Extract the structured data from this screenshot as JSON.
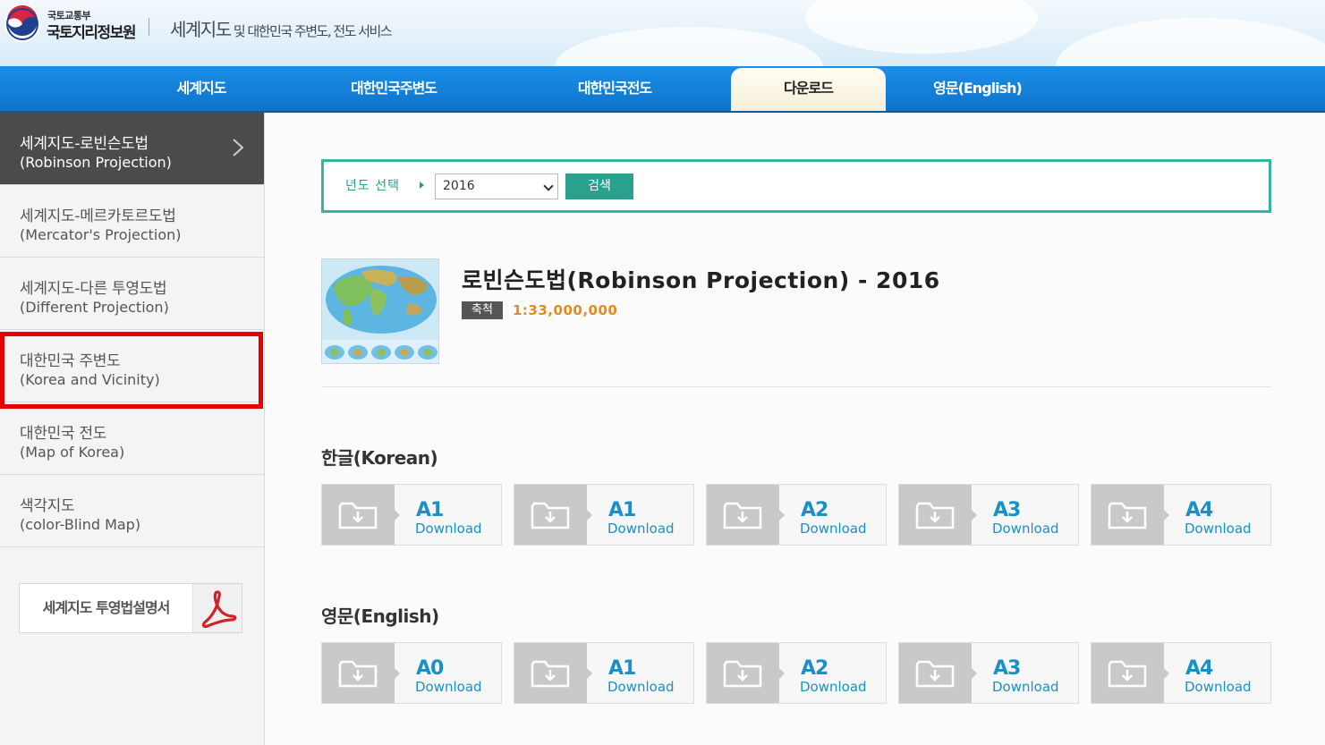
{
  "header": {
    "ministry": "국토교통부",
    "org": "국토지리정보원",
    "service_title_main": "세계지도",
    "service_title_rest": " 및 대한민국 주변도, 전도 서비스"
  },
  "nav": {
    "items": [
      {
        "label": "세계지도"
      },
      {
        "label": "대한민국주변도"
      },
      {
        "label": "대한민국전도"
      },
      {
        "label": "다운로드",
        "active": true
      },
      {
        "label": "영문(English)"
      }
    ]
  },
  "sidebar": {
    "items": [
      {
        "ko": "세계지도-로빈슨도법",
        "en": "(Robinson Projection)",
        "active": true
      },
      {
        "ko": "세계지도-메르카토르도법",
        "en": "(Mercator's Projection)"
      },
      {
        "ko": "세계지도-다른 투영도법",
        "en": "(Different Projection)"
      },
      {
        "ko": "대한민국 주변도",
        "en": "(Korea and Vicinity)",
        "highlighted": true
      },
      {
        "ko": "대한민국 전도",
        "en": "(Map of Korea)"
      },
      {
        "ko": "색각지도",
        "en": "(color-Blind Map)"
      }
    ],
    "pdf_button_label": "세계지도 투영법설명서",
    "pdf_icon": "pdf-icon"
  },
  "search": {
    "label": "년도 선택",
    "selected_year": "2016",
    "button_label": "검색"
  },
  "map_info": {
    "title": "로빈슨도법(Robinson Projection) - 2016",
    "scale_label": "축척",
    "scale_value": "1:33,000,000"
  },
  "sections": {
    "korean_title": "한글(Korean)",
    "english_title": "영문(English)",
    "korean_downloads": [
      {
        "size": "A",
        "num": "1",
        "text": "Download"
      },
      {
        "size": "A",
        "num": "1",
        "text": "Download"
      },
      {
        "size": "A",
        "num": "2",
        "text": "Download"
      },
      {
        "size": "A",
        "num": "3",
        "text": "Download"
      },
      {
        "size": "A",
        "num": "4",
        "text": "Download"
      }
    ],
    "english_downloads": [
      {
        "size": "A",
        "num": "0",
        "text": "Download"
      },
      {
        "size": "A",
        "num": "1",
        "text": "Download"
      },
      {
        "size": "A",
        "num": "2",
        "text": "Download"
      },
      {
        "size": "A",
        "num": "3",
        "text": "Download"
      },
      {
        "size": "A",
        "num": "4",
        "text": "Download"
      }
    ]
  },
  "colors": {
    "nav_blue": "#0d74cc",
    "accent_teal": "#34b59f",
    "download_blue": "#1890c8",
    "scale_orange": "#e58a1f",
    "highlight_red": "#e60000"
  }
}
